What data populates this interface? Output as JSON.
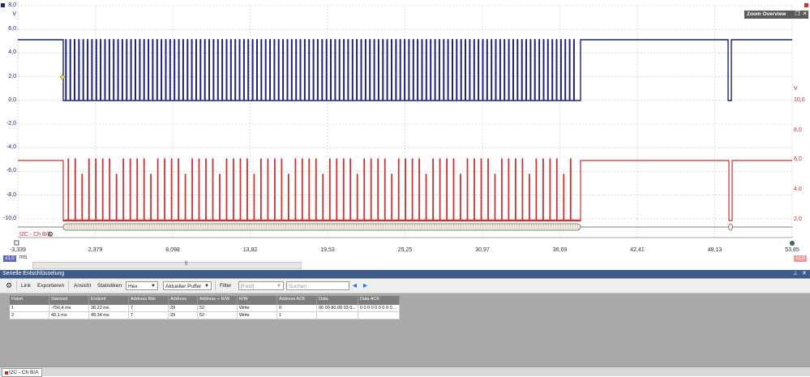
{
  "scope": {
    "y_left_unit": "V",
    "y_right_unit": "V",
    "y_left_ticks": [
      "8,0",
      "6,0",
      "4,0",
      "2,0",
      "0,0",
      "-2,0",
      "-4,0",
      "-6,0",
      "-8,0",
      "-10,0"
    ],
    "y_right_ticks": [
      "10,0",
      "8,0",
      "6,0",
      "4,0",
      "2,0"
    ],
    "x_ticks": [
      "-3,339",
      "2,379",
      "8,098",
      "13,82",
      "19,53",
      "25,25",
      "30,97",
      "36,69",
      "42,41",
      "48,13",
      "53,85"
    ],
    "x_unit": "ms",
    "zoom_overview_title": "Zoom Overview",
    "decoder_channel_label": "I2C - Ch B/A",
    "left_scale_tag": "x1,0",
    "right_scale_tag": "x1,0",
    "channel_colors": {
      "A": "#1a237e",
      "B": "#d32f2f"
    }
  },
  "decoder": {
    "title": "Serielle Entschlüsselung",
    "toolbar": {
      "link": "Link",
      "export": "Exportieren",
      "view": "Ansicht",
      "stats": "Statistiken",
      "format": "Hex",
      "buffer": "Aktueller Puffer",
      "filter": "Filter",
      "field_placeholder": "[Feld]",
      "search_placeholder": "Suchen"
    },
    "columns": [
      "Paket",
      "Startzeit",
      "Endzeit",
      "Address Bits",
      "Address",
      "Address + R/W",
      "R/W",
      "Address ACK",
      "Data",
      "Data ACK"
    ],
    "rows": [
      [
        "1",
        "-756,4 ms",
        "38,22 ms",
        "7",
        "29",
        "52",
        "Write",
        "0",
        "00 00 80 00 03 0...",
        "0 0 0 0 0 0 0 0 0 ..."
      ],
      [
        "2",
        "49,1 ms",
        "49,34 ms",
        "7",
        "29",
        "52",
        "Write",
        "1",
        "",
        ""
      ]
    ],
    "bottom_tab": "I2C - Ch B/A"
  }
}
